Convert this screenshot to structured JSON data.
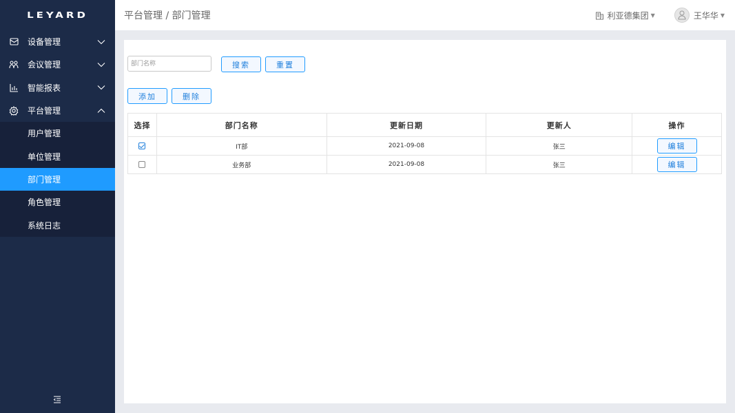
{
  "app": {
    "logo": "LEYARD"
  },
  "sidebar": {
    "groups": [
      {
        "label": "设备管理",
        "icon": "device-icon",
        "expanded": false
      },
      {
        "label": "会议管理",
        "icon": "meeting-icon",
        "expanded": false
      },
      {
        "label": "智能报表",
        "icon": "chart-icon",
        "expanded": false
      },
      {
        "label": "平台管理",
        "icon": "gear-icon",
        "expanded": true
      }
    ],
    "submenu": [
      {
        "label": "用户管理",
        "active": false
      },
      {
        "label": "单位管理",
        "active": false
      },
      {
        "label": "部门管理",
        "active": true
      },
      {
        "label": "角色管理",
        "active": false
      },
      {
        "label": "系统日志",
        "active": false
      }
    ]
  },
  "header": {
    "breadcrumb": "平台管理 / 部门管理",
    "org": "利亚德集团",
    "user": "王华华"
  },
  "filters": {
    "name_placeholder": "部门名称",
    "search_label": "搜索",
    "reset_label": "重置"
  },
  "actions": {
    "add_label": "添加",
    "delete_label": "删除"
  },
  "table": {
    "columns": [
      "选择",
      "部门名称",
      "更新日期",
      "更新人",
      "操作"
    ],
    "rows": [
      {
        "checked": true,
        "name": "IT部",
        "date": "2021-09-08",
        "updater": "张三",
        "action": "编辑"
      },
      {
        "checked": false,
        "name": "业务部",
        "date": "2021-09-08",
        "updater": "张三",
        "action": "编辑"
      }
    ]
  },
  "colors": {
    "sidebar": "#1c2b48",
    "accent": "#1f9bff",
    "submenu": "#17213a"
  }
}
